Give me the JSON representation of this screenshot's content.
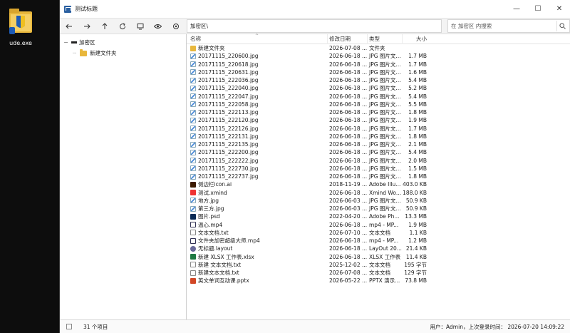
{
  "desktop": {
    "icon_label": "ude.exe"
  },
  "window": {
    "title": "测试标题",
    "controls": {
      "minimize": "—",
      "maximize": "☐",
      "close": "✕"
    }
  },
  "toolbar": {
    "address": "加密区\\",
    "search_placeholder": "在 加密区 内搜索"
  },
  "tree": {
    "root": "加密区",
    "child": "新建文件夹"
  },
  "columns": {
    "name": "名称",
    "date": "修改日期",
    "type": "类型",
    "size": "大小"
  },
  "files": [
    {
      "name": "新建文件夹",
      "date": "2026-07-08 ...",
      "type": "文件夹",
      "size": "",
      "icon": "folder"
    },
    {
      "name": "20171115_220600.jpg",
      "date": "2026-06-18 ...",
      "type": "JPG 图片文...",
      "size": "1.7 MB",
      "icon": "jpg"
    },
    {
      "name": "20171115_220618.jpg",
      "date": "2026-06-18 ...",
      "type": "JPG 图片文...",
      "size": "1.7 MB",
      "icon": "jpg"
    },
    {
      "name": "20171115_220631.jpg",
      "date": "2026-06-18 ...",
      "type": "JPG 图片文...",
      "size": "1.6 MB",
      "icon": "jpg"
    },
    {
      "name": "20171115_222036.jpg",
      "date": "2026-06-18 ...",
      "type": "JPG 图片文...",
      "size": "5.4 MB",
      "icon": "jpg"
    },
    {
      "name": "20171115_222040.jpg",
      "date": "2026-06-18 ...",
      "type": "JPG 图片文...",
      "size": "5.2 MB",
      "icon": "jpg"
    },
    {
      "name": "20171115_222047.jpg",
      "date": "2026-06-18 ...",
      "type": "JPG 图片文...",
      "size": "5.4 MB",
      "icon": "jpg"
    },
    {
      "name": "20171115_222058.jpg",
      "date": "2026-06-18 ...",
      "type": "JPG 图片文...",
      "size": "5.5 MB",
      "icon": "jpg"
    },
    {
      "name": "20171115_222113.jpg",
      "date": "2026-06-18 ...",
      "type": "JPG 图片文...",
      "size": "1.8 MB",
      "icon": "jpg"
    },
    {
      "name": "20171115_222120.jpg",
      "date": "2026-06-18 ...",
      "type": "JPG 图片文...",
      "size": "1.9 MB",
      "icon": "jpg"
    },
    {
      "name": "20171115_222126.jpg",
      "date": "2026-06-18 ...",
      "type": "JPG 图片文...",
      "size": "1.7 MB",
      "icon": "jpg"
    },
    {
      "name": "20171115_222131.jpg",
      "date": "2026-06-18 ...",
      "type": "JPG 图片文...",
      "size": "1.8 MB",
      "icon": "jpg"
    },
    {
      "name": "20171115_222135.jpg",
      "date": "2026-06-18 ...",
      "type": "JPG 图片文...",
      "size": "2.1 MB",
      "icon": "jpg"
    },
    {
      "name": "20171115_222200.jpg",
      "date": "2026-06-18 ...",
      "type": "JPG 图片文...",
      "size": "5.4 MB",
      "icon": "jpg"
    },
    {
      "name": "20171115_222222.jpg",
      "date": "2026-06-18 ...",
      "type": "JPG 图片文...",
      "size": "2.0 MB",
      "icon": "jpg"
    },
    {
      "name": "20171115_222730.jpg",
      "date": "2026-06-18 ...",
      "type": "JPG 图片文...",
      "size": "1.5 MB",
      "icon": "jpg"
    },
    {
      "name": "20171115_222737.jpg",
      "date": "2026-06-18 ...",
      "type": "JPG 图片文...",
      "size": "1.8 MB",
      "icon": "jpg"
    },
    {
      "name": "侧边栏icon.ai",
      "date": "2018-11-19 ...",
      "type": "Adobe Illu...",
      "size": "403.0 KB",
      "icon": "ai"
    },
    {
      "name": "测试.xmind",
      "date": "2026-06-18 ...",
      "type": "Xmind Wo...",
      "size": "188.0 KB",
      "icon": "xmind"
    },
    {
      "name": "地方.jpg",
      "date": "2026-06-03 ...",
      "type": "JPG 图片文...",
      "size": "50.9 KB",
      "icon": "jpg"
    },
    {
      "name": "第三方.jpg",
      "date": "2026-06-03 ...",
      "type": "JPG 图片文...",
      "size": "50.9 KB",
      "icon": "jpg"
    },
    {
      "name": "图片.psd",
      "date": "2022-04-20 ...",
      "type": "Adobe Ph...",
      "size": "13.3 MB",
      "icon": "psd"
    },
    {
      "name": "温心.mp4",
      "date": "2026-06-18 ...",
      "type": "mp4 - MP...",
      "size": "1.9 MB",
      "icon": "mp4"
    },
    {
      "name": "文本文档.txt",
      "date": "2026-07-10 ...",
      "type": "文本文档",
      "size": "1.1 KB",
      "icon": "txt"
    },
    {
      "name": "文件夹加密超级大师.mp4",
      "date": "2026-06-18 ...",
      "type": "mp4 - MP...",
      "size": "1.2 MB",
      "icon": "mp4"
    },
    {
      "name": "无标题.layout",
      "date": "2026-06-18 ...",
      "type": "LayOut 20...",
      "size": "21.4 KB",
      "icon": "layout"
    },
    {
      "name": "新建 XLSX 工作表.xlsx",
      "date": "2026-06-18 ...",
      "type": "XLSX 工作表",
      "size": "11.4 KB",
      "icon": "xlsx"
    },
    {
      "name": "新建 文本文档.txt",
      "date": "2025-12-02 ...",
      "type": "文本文档",
      "size": "195 字节",
      "icon": "txt"
    },
    {
      "name": "新建文本文档.txt",
      "date": "2026-07-08 ...",
      "type": "文本文档",
      "size": "129 字节",
      "icon": "txt"
    },
    {
      "name": "英文单词互动课.pptx",
      "date": "2026-05-22 ...",
      "type": "PPTX 演示...",
      "size": "73.8 MB",
      "icon": "pptx"
    }
  ],
  "status": {
    "count": "31 个项目",
    "user": "用户：Admin，上次登录时间： 2026-07-20  14:09:22"
  }
}
